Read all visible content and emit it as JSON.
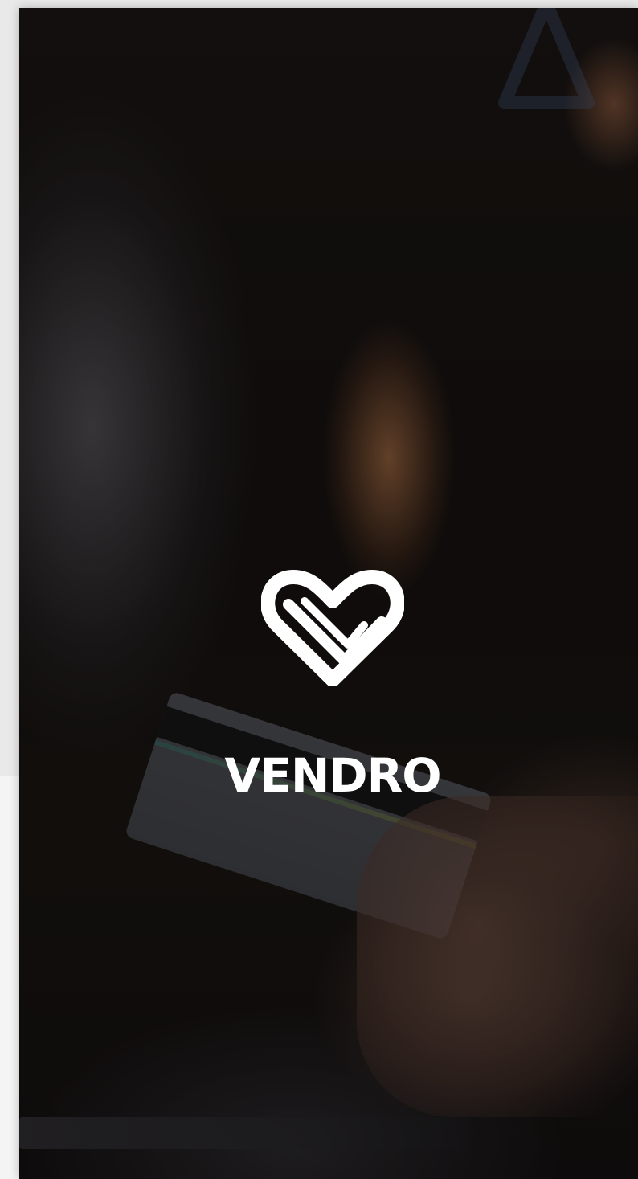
{
  "app": {
    "brand_name": "VENDRO"
  },
  "icons": {
    "logo": "heart-check-icon",
    "corner": "triangle-logo-icon"
  },
  "colors": {
    "brand_text": "#ffffff",
    "background_dark": "#0f0d0c",
    "page_bg": "#f1f1f2"
  }
}
